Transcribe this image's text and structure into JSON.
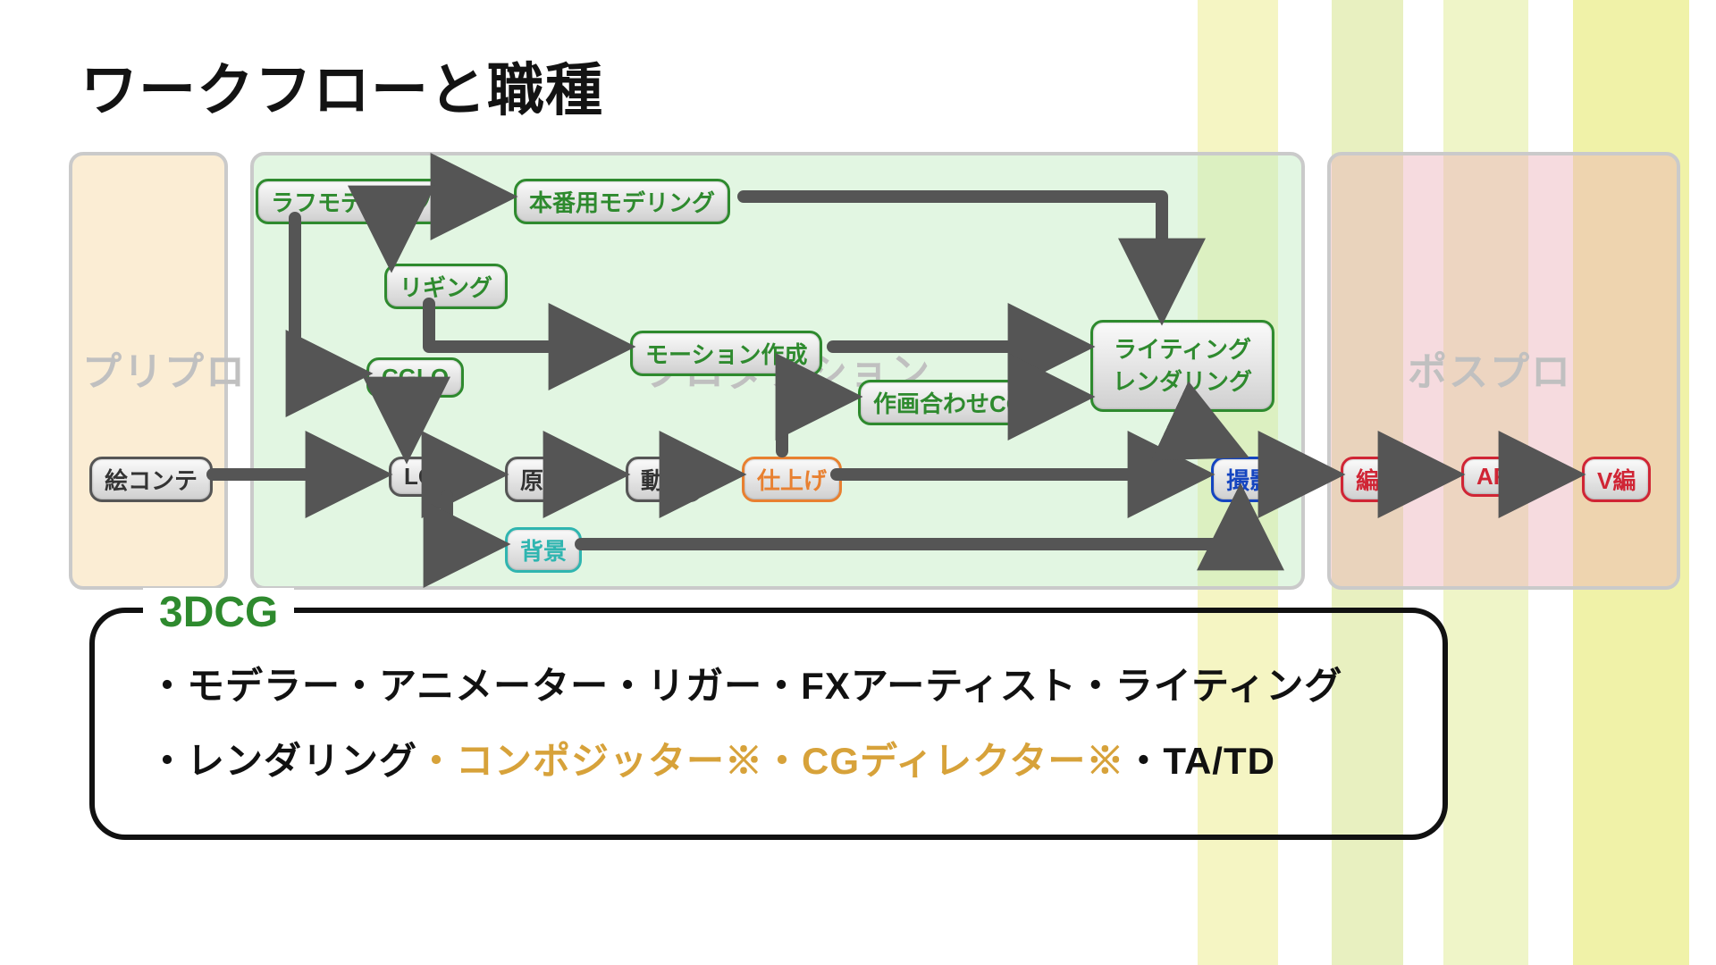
{
  "title": "ワークフローと職種",
  "stages": {
    "pre": "プリプロ",
    "prod": "プロダクション",
    "post": "ポスプロ"
  },
  "nodes": {
    "roughModel": "ラフモデリング",
    "finalModel": "本番用モデリング",
    "rigging": "リギング",
    "cglo": "CGLO",
    "motion": "モーション作成",
    "sakugaCG": "作画合わせCG",
    "lightRender": "ライティング\nレンダリング",
    "econte": "絵コンテ",
    "lo": "LO",
    "genga": "原画",
    "douga": "動画",
    "shiage": "仕上げ",
    "haikei": "背景",
    "satsuei": "撮影",
    "henshu": "編集",
    "ar": "AR",
    "vhen": "V編"
  },
  "roles": {
    "heading": "3DCG",
    "line1": "・モデラー・アニメーター・リガー・FXアーティスト・ライティング",
    "line2a": "・レンダリング",
    "line2b": "・コンポジッター※・CGディレクター※",
    "line2c": "・TA/TD"
  }
}
